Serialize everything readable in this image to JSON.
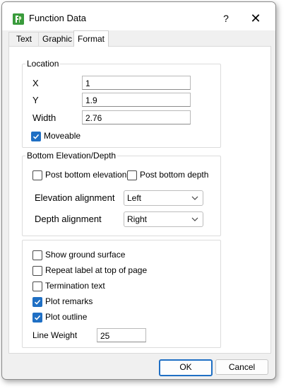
{
  "window": {
    "title": "Function Data",
    "help_label": "?",
    "close_label": "✕"
  },
  "tabs": [
    {
      "label": "Text",
      "active": false
    },
    {
      "label": "Graphic",
      "active": false
    },
    {
      "label": "Format",
      "active": true
    }
  ],
  "location": {
    "legend": "Location",
    "x_label": "X",
    "x_value": "1",
    "y_label": "Y",
    "y_value": "1.9",
    "width_label": "Width",
    "width_value": "2.76",
    "moveable_label": "Moveable",
    "moveable_checked": true
  },
  "bottom": {
    "legend": "Bottom Elevation/Depth",
    "post_elevation_label": "Post bottom elevation",
    "post_elevation_checked": false,
    "post_depth_label": "Post bottom depth",
    "post_depth_checked": false,
    "elevation_alignment_label": "Elevation alignment",
    "elevation_alignment_value": "Left",
    "depth_alignment_label": "Depth alignment",
    "depth_alignment_value": "Right"
  },
  "options": {
    "show_ground_label": "Show ground surface",
    "show_ground_checked": false,
    "repeat_label_label": "Repeat label at top of page",
    "repeat_label_checked": false,
    "termination_label": "Termination text",
    "termination_checked": false,
    "plot_remarks_label": "Plot remarks",
    "plot_remarks_checked": true,
    "plot_outline_label": "Plot outline",
    "plot_outline_checked": true,
    "line_weight_label": "Line Weight",
    "line_weight_value": "25"
  },
  "buttons": {
    "ok_label": "OK",
    "cancel_label": "Cancel"
  },
  "colors": {
    "accent": "#1f6fc4",
    "icon_green": "#3a9b3c"
  }
}
